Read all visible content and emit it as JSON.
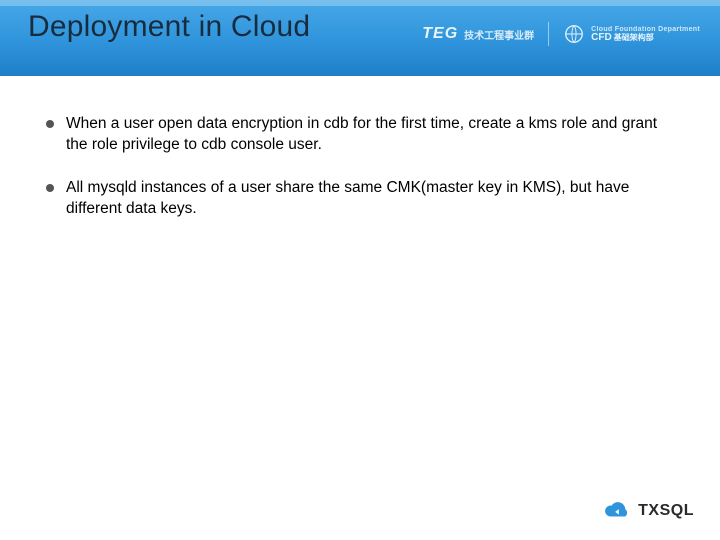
{
  "slide": {
    "title": "Deployment in Cloud",
    "bullets": [
      "When a user open data encryption in cdb for the first time, create a kms role and grant the role privilege to cdb console user.",
      "All mysqld instances of a user share the same CMK(master key in KMS), but have different data keys."
    ]
  },
  "logos": {
    "teg": {
      "mark": "TEG",
      "sub": "技术工程事业群"
    },
    "cfd": {
      "small": "Cloud Foundation Department",
      "label": "CFD",
      "cn": "基础架构部"
    }
  },
  "footer": {
    "product": "TXSQL"
  }
}
